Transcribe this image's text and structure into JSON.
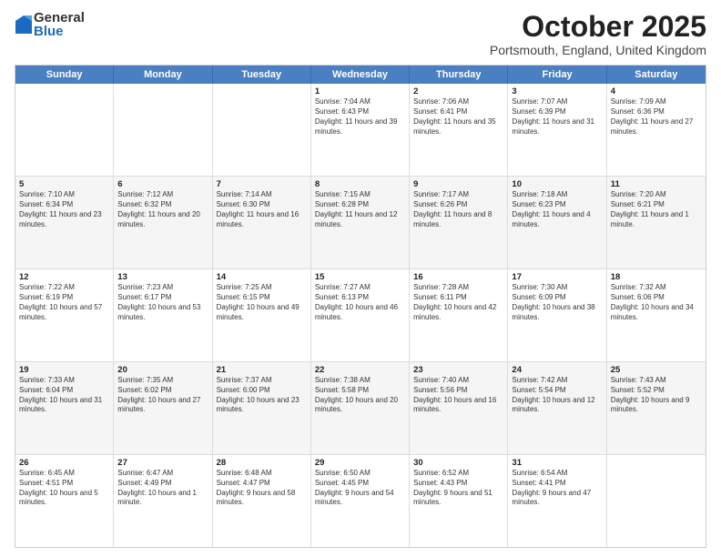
{
  "logo": {
    "general": "General",
    "blue": "Blue"
  },
  "title": "October 2025",
  "location": "Portsmouth, England, United Kingdom",
  "days_of_week": [
    "Sunday",
    "Monday",
    "Tuesday",
    "Wednesday",
    "Thursday",
    "Friday",
    "Saturday"
  ],
  "weeks": [
    [
      {
        "day": "",
        "sunrise": "",
        "sunset": "",
        "daylight": ""
      },
      {
        "day": "",
        "sunrise": "",
        "sunset": "",
        "daylight": ""
      },
      {
        "day": "",
        "sunrise": "",
        "sunset": "",
        "daylight": ""
      },
      {
        "day": "1",
        "sunrise": "Sunrise: 7:04 AM",
        "sunset": "Sunset: 6:43 PM",
        "daylight": "Daylight: 11 hours and 39 minutes."
      },
      {
        "day": "2",
        "sunrise": "Sunrise: 7:06 AM",
        "sunset": "Sunset: 6:41 PM",
        "daylight": "Daylight: 11 hours and 35 minutes."
      },
      {
        "day": "3",
        "sunrise": "Sunrise: 7:07 AM",
        "sunset": "Sunset: 6:39 PM",
        "daylight": "Daylight: 11 hours and 31 minutes."
      },
      {
        "day": "4",
        "sunrise": "Sunrise: 7:09 AM",
        "sunset": "Sunset: 6:36 PM",
        "daylight": "Daylight: 11 hours and 27 minutes."
      }
    ],
    [
      {
        "day": "5",
        "sunrise": "Sunrise: 7:10 AM",
        "sunset": "Sunset: 6:34 PM",
        "daylight": "Daylight: 11 hours and 23 minutes."
      },
      {
        "day": "6",
        "sunrise": "Sunrise: 7:12 AM",
        "sunset": "Sunset: 6:32 PM",
        "daylight": "Daylight: 11 hours and 20 minutes."
      },
      {
        "day": "7",
        "sunrise": "Sunrise: 7:14 AM",
        "sunset": "Sunset: 6:30 PM",
        "daylight": "Daylight: 11 hours and 16 minutes."
      },
      {
        "day": "8",
        "sunrise": "Sunrise: 7:15 AM",
        "sunset": "Sunset: 6:28 PM",
        "daylight": "Daylight: 11 hours and 12 minutes."
      },
      {
        "day": "9",
        "sunrise": "Sunrise: 7:17 AM",
        "sunset": "Sunset: 6:26 PM",
        "daylight": "Daylight: 11 hours and 8 minutes."
      },
      {
        "day": "10",
        "sunrise": "Sunrise: 7:18 AM",
        "sunset": "Sunset: 6:23 PM",
        "daylight": "Daylight: 11 hours and 4 minutes."
      },
      {
        "day": "11",
        "sunrise": "Sunrise: 7:20 AM",
        "sunset": "Sunset: 6:21 PM",
        "daylight": "Daylight: 11 hours and 1 minute."
      }
    ],
    [
      {
        "day": "12",
        "sunrise": "Sunrise: 7:22 AM",
        "sunset": "Sunset: 6:19 PM",
        "daylight": "Daylight: 10 hours and 57 minutes."
      },
      {
        "day": "13",
        "sunrise": "Sunrise: 7:23 AM",
        "sunset": "Sunset: 6:17 PM",
        "daylight": "Daylight: 10 hours and 53 minutes."
      },
      {
        "day": "14",
        "sunrise": "Sunrise: 7:25 AM",
        "sunset": "Sunset: 6:15 PM",
        "daylight": "Daylight: 10 hours and 49 minutes."
      },
      {
        "day": "15",
        "sunrise": "Sunrise: 7:27 AM",
        "sunset": "Sunset: 6:13 PM",
        "daylight": "Daylight: 10 hours and 46 minutes."
      },
      {
        "day": "16",
        "sunrise": "Sunrise: 7:28 AM",
        "sunset": "Sunset: 6:11 PM",
        "daylight": "Daylight: 10 hours and 42 minutes."
      },
      {
        "day": "17",
        "sunrise": "Sunrise: 7:30 AM",
        "sunset": "Sunset: 6:09 PM",
        "daylight": "Daylight: 10 hours and 38 minutes."
      },
      {
        "day": "18",
        "sunrise": "Sunrise: 7:32 AM",
        "sunset": "Sunset: 6:06 PM",
        "daylight": "Daylight: 10 hours and 34 minutes."
      }
    ],
    [
      {
        "day": "19",
        "sunrise": "Sunrise: 7:33 AM",
        "sunset": "Sunset: 6:04 PM",
        "daylight": "Daylight: 10 hours and 31 minutes."
      },
      {
        "day": "20",
        "sunrise": "Sunrise: 7:35 AM",
        "sunset": "Sunset: 6:02 PM",
        "daylight": "Daylight: 10 hours and 27 minutes."
      },
      {
        "day": "21",
        "sunrise": "Sunrise: 7:37 AM",
        "sunset": "Sunset: 6:00 PM",
        "daylight": "Daylight: 10 hours and 23 minutes."
      },
      {
        "day": "22",
        "sunrise": "Sunrise: 7:38 AM",
        "sunset": "Sunset: 5:58 PM",
        "daylight": "Daylight: 10 hours and 20 minutes."
      },
      {
        "day": "23",
        "sunrise": "Sunrise: 7:40 AM",
        "sunset": "Sunset: 5:56 PM",
        "daylight": "Daylight: 10 hours and 16 minutes."
      },
      {
        "day": "24",
        "sunrise": "Sunrise: 7:42 AM",
        "sunset": "Sunset: 5:54 PM",
        "daylight": "Daylight: 10 hours and 12 minutes."
      },
      {
        "day": "25",
        "sunrise": "Sunrise: 7:43 AM",
        "sunset": "Sunset: 5:52 PM",
        "daylight": "Daylight: 10 hours and 9 minutes."
      }
    ],
    [
      {
        "day": "26",
        "sunrise": "Sunrise: 6:45 AM",
        "sunset": "Sunset: 4:51 PM",
        "daylight": "Daylight: 10 hours and 5 minutes."
      },
      {
        "day": "27",
        "sunrise": "Sunrise: 6:47 AM",
        "sunset": "Sunset: 4:49 PM",
        "daylight": "Daylight: 10 hours and 1 minute."
      },
      {
        "day": "28",
        "sunrise": "Sunrise: 6:48 AM",
        "sunset": "Sunset: 4:47 PM",
        "daylight": "Daylight: 9 hours and 58 minutes."
      },
      {
        "day": "29",
        "sunrise": "Sunrise: 6:50 AM",
        "sunset": "Sunset: 4:45 PM",
        "daylight": "Daylight: 9 hours and 54 minutes."
      },
      {
        "day": "30",
        "sunrise": "Sunrise: 6:52 AM",
        "sunset": "Sunset: 4:43 PM",
        "daylight": "Daylight: 9 hours and 51 minutes."
      },
      {
        "day": "31",
        "sunrise": "Sunrise: 6:54 AM",
        "sunset": "Sunset: 4:41 PM",
        "daylight": "Daylight: 9 hours and 47 minutes."
      },
      {
        "day": "",
        "sunrise": "",
        "sunset": "",
        "daylight": ""
      }
    ]
  ]
}
